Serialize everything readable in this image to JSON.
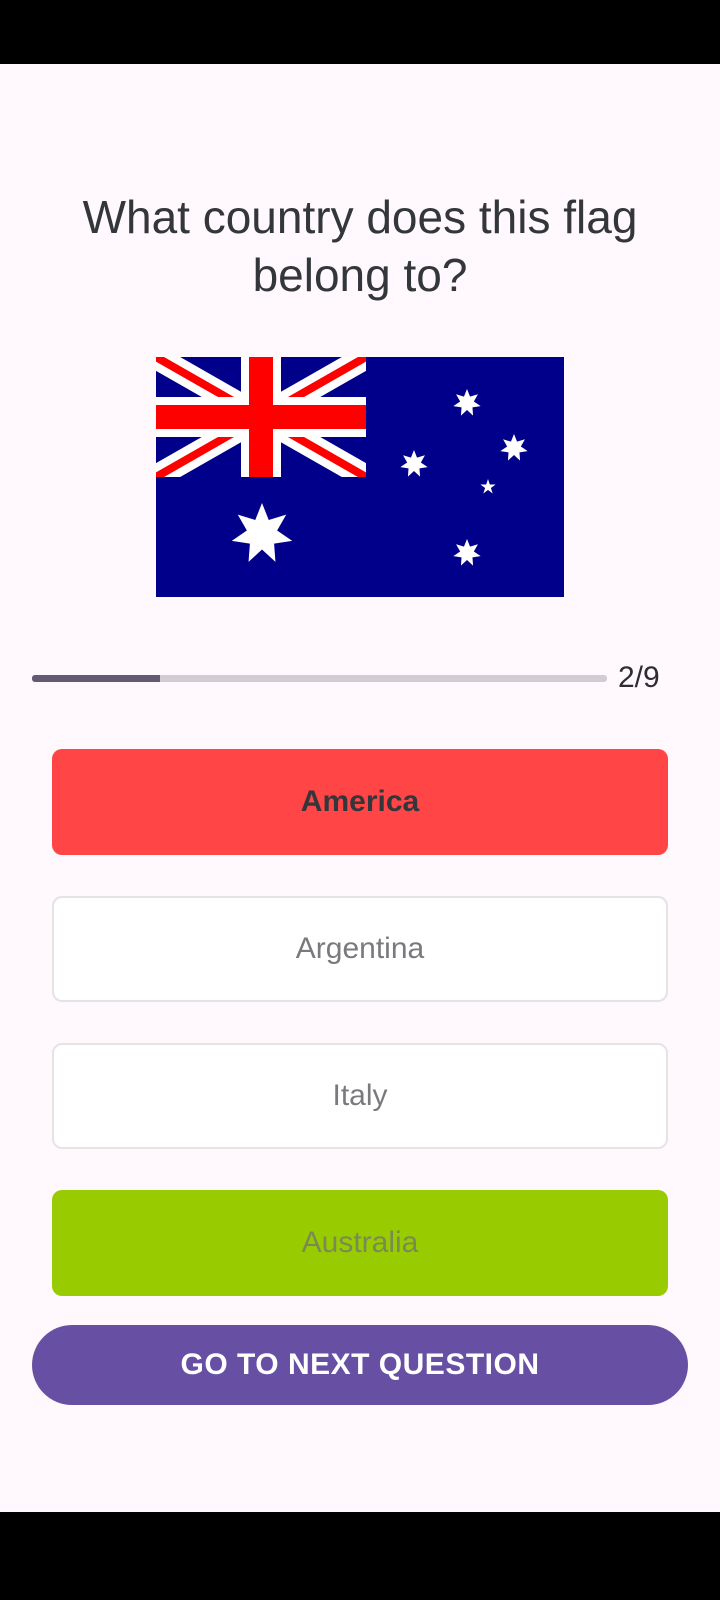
{
  "quiz": {
    "question": "What country does this flag belong to?",
    "progress": {
      "text": "2/9",
      "fraction": 0.222
    },
    "options": [
      {
        "label": "America",
        "state": "selected-wrong"
      },
      {
        "label": "Argentina",
        "state": "default"
      },
      {
        "label": "Italy",
        "state": "default"
      },
      {
        "label": "Australia",
        "state": "correct"
      }
    ],
    "next_button_label": "GO TO NEXT QUESTION"
  },
  "flag_image": {
    "icon": "australia-flag",
    "colors": {
      "blue": "#00008B",
      "red": "#FF0000",
      "white": "#FFFFFF"
    }
  },
  "colors": {
    "background": "#FFF8FC",
    "wrong": "#FF4545",
    "correct": "#99CC00",
    "primary": "#6750A4",
    "progress_fill": "#625B71",
    "progress_track": "#D4CCD3"
  }
}
